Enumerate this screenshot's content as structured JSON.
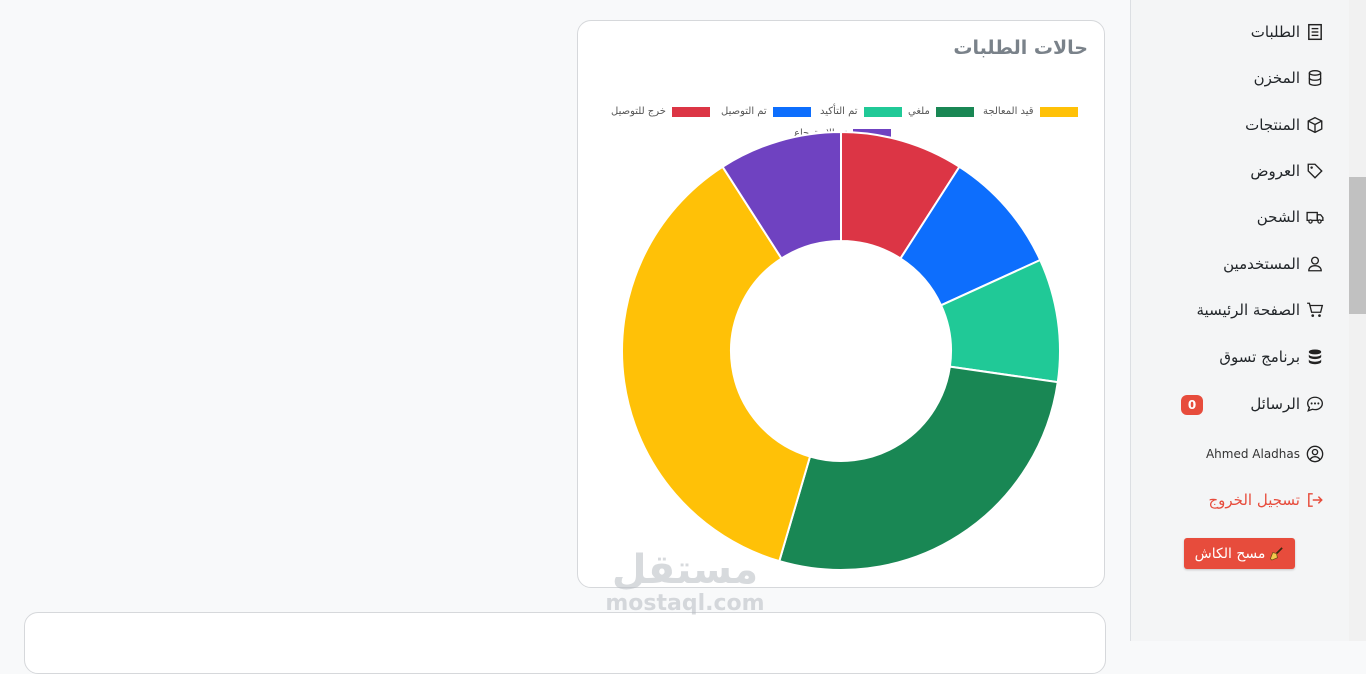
{
  "chart_card": {
    "title": "حالات الطلبات"
  },
  "chart_data": {
    "type": "doughnut",
    "title": "حالات الطلبات",
    "legend_position": "top",
    "categories": [
      "خرج للتوصيل",
      "تم التوصيل",
      "تم التأكيد",
      "ملغي",
      "قيد المعالجة",
      "تم الاسترجاع"
    ],
    "values": [
      1,
      1,
      1,
      3,
      4,
      1
    ],
    "colors": [
      "#dc3545",
      "#0d6efd",
      "#20c997",
      "#198754",
      "#ffc107",
      "#6f42c1"
    ]
  },
  "sidebar": {
    "items": [
      {
        "label": "الطلبات",
        "icon": "orders-icon"
      },
      {
        "label": "المخزن",
        "icon": "database-icon"
      },
      {
        "label": "المنتجات",
        "icon": "box-icon"
      },
      {
        "label": "العروض",
        "icon": "tags-icon"
      },
      {
        "label": "الشحن",
        "icon": "truck-icon"
      },
      {
        "label": "المستخدمين",
        "icon": "user-icon"
      },
      {
        "label": "الصفحة الرئيسية",
        "icon": "cart-icon"
      },
      {
        "label": "برنامج تسوق",
        "icon": "coins-icon"
      },
      {
        "label": "الرسائل",
        "icon": "chat-icon"
      }
    ],
    "messages_badge": "0",
    "user_name": "Ahmed Aladhas",
    "logout_label": "تسجيل الخروج",
    "clear_cache_label": "مسح الكاش"
  },
  "watermark": {
    "arabic": "مستقل",
    "latin": "mostaql.com"
  },
  "theme": {
    "danger": "#e74c3c",
    "card_border": "#d6d8db"
  }
}
